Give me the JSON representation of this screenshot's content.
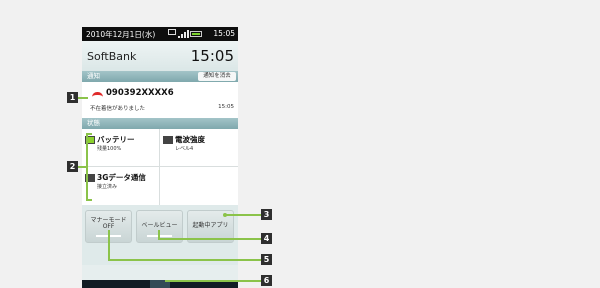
{
  "status_bar": {
    "date": "2010年12月1日(水)",
    "time": "15:05"
  },
  "header": {
    "carrier": "SoftBank",
    "clock": "15:05"
  },
  "sections": {
    "notification": "通知",
    "clear_button": "通知を消去",
    "state": "状態"
  },
  "notification": {
    "number": "090392XXXX6",
    "message": "不在着信がありました",
    "time": "15:05"
  },
  "status_cells": [
    {
      "title": "バッテリー",
      "subtitle": "残量100%"
    },
    {
      "title": "電波強度",
      "subtitle": "レベル4"
    },
    {
      "title": "3Gデータ通信",
      "subtitle": "接立済み"
    }
  ],
  "quick_buttons": [
    {
      "label": "マナーモード",
      "value": "OFF"
    },
    {
      "label": "ベールビュー",
      "value": ""
    },
    {
      "label": "起動中アプリ",
      "value": ""
    }
  ],
  "callouts": [
    "1",
    "2",
    "3",
    "4",
    "5",
    "6"
  ],
  "colors": {
    "accent": "#8bc34a",
    "callout": "#2f2f2f",
    "missed_call": "#e02a2a"
  }
}
